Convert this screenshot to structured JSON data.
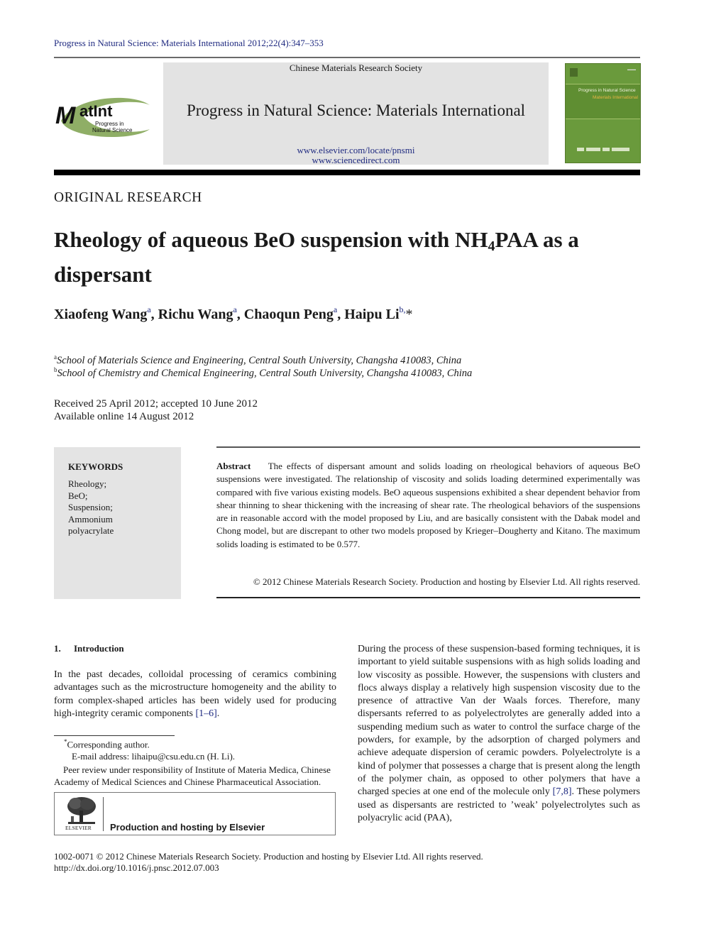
{
  "running_head": "Progress in Natural Science: Materials International 2012;22(4):347–353",
  "header": {
    "society": "Chinese Materials Research Society",
    "journal_title": "Progress in Natural Science: Materials International",
    "url_publisher": "www.elsevier.com/locate/pnsmi",
    "url_sciencedirect": "www.sciencedirect.com",
    "logo": {
      "main": "MatInt",
      "sub1": "Progress in",
      "sub2": "Natural Science"
    },
    "cover": {
      "title_line1": "Progress in Natural Science",
      "title_line2": "Materials International"
    }
  },
  "article": {
    "section_type": "ORIGINAL RESEARCH",
    "title_part1": "Rheology of aqueous BeO suspension with NH",
    "title_sub": "4",
    "title_part2": "PAA as a dispersant",
    "authors": [
      {
        "name": "Xiaofeng Wang",
        "aff": "a"
      },
      {
        "name": "Richu Wang",
        "aff": "a"
      },
      {
        "name": "Chaoqun Peng",
        "aff": "a"
      },
      {
        "name": "Haipu Li",
        "aff": "b,",
        "star": "*"
      }
    ],
    "affiliations": [
      {
        "label": "a",
        "text": "School of Materials Science and Engineering, Central South University, Changsha 410083, China"
      },
      {
        "label": "b",
        "text": "School of Chemistry and Chemical Engineering, Central South University, Changsha 410083, China"
      }
    ],
    "received": "Received 25 April 2012; accepted 10 June 2012",
    "available": "Available online 14 August 2012"
  },
  "keywords": {
    "heading": "KEYWORDS",
    "items": [
      "Rheology;",
      "BeO;",
      "Suspension;",
      "Ammonium",
      "polyacrylate"
    ]
  },
  "abstract": {
    "label": "Abstract",
    "text": "The effects of dispersant amount and solids loading on rheological behaviors of aqueous BeO suspensions were investigated. The relationship of viscosity and solids loading determined experimentally was compared with five various existing models. BeO aqueous suspensions exhibited a shear dependent behavior from shear thinning to shear thickening with the increasing of shear rate. The rheological behaviors of the suspensions are in reasonable accord with the model proposed by Liu, and are basically consistent with the Dabak model and Chong model, but are discrepant to other two models proposed by Krieger–Dougherty and Kitano. The maximum solids loading is estimated to be 0.577.",
    "copyright": "© 2012 Chinese Materials Research Society. Production and hosting by Elsevier Ltd. All rights reserved."
  },
  "intro": {
    "number": "1.",
    "heading": "Introduction",
    "p1_text": "In the past decades, colloidal processing of ceramics combining advantages such as the microstructure homogeneity and the ability to form complex-shaped articles has been widely used for producing high-integrity ceramic components ",
    "p1_ref": "[1–6]",
    "p1_end": ".",
    "col2_text": "During the process of these suspension-based forming techniques, it is important to yield suitable suspensions with as high solids loading and low viscosity as possible. However, the suspensions with clusters and flocs always display a relatively high suspension viscosity due to the presence of attractive Van der Waals forces. Therefore, many dispersants referred to as polyelectrolytes are generally added into a suspending medium such as water to control the surface charge of the powders, for example, by the adsorption of charged polymers and achieve adequate dispersion of ceramic powders. Polyelectrolyte is a kind of polymer that possesses a charge that is present along the length of the polymer chain, as opposed to other polymers that have a charged species at one end of the molecule only ",
    "col2_ref": "[7,8]",
    "col2_end": ". These polymers used as dispersants are restricted to ’weak’ polyelectrolytes such as polyacrylic acid (PAA),"
  },
  "footnotes": {
    "corresponding_star": "*",
    "corresponding": "Corresponding author.",
    "email_label": "E-mail address: ",
    "email": "lihaipu@csu.edu.cn",
    "email_suffix": " (H. Li).",
    "peer_review": "Peer review under responsibility of Institute of Materia Medica, Chinese Academy of Medical Sciences and Chinese Pharmaceutical Association."
  },
  "elsevier_box": {
    "wordmark": "ELSEVIER",
    "text": "Production and hosting by Elsevier"
  },
  "bottom": {
    "issn_line": "1002-0071 © 2012 Chinese Materials Research Society. Production and hosting by Elsevier Ltd. All rights reserved.",
    "doi_line": "http://dx.doi.org/10.1016/j.pnsc.2012.07.003"
  },
  "colors": {
    "link": "#1f2a80",
    "header_band": "#e3e3e3",
    "keywords_box": "#e4e4e4",
    "cover_green": "#6a9a3c",
    "logo_green": "#8fae66"
  }
}
